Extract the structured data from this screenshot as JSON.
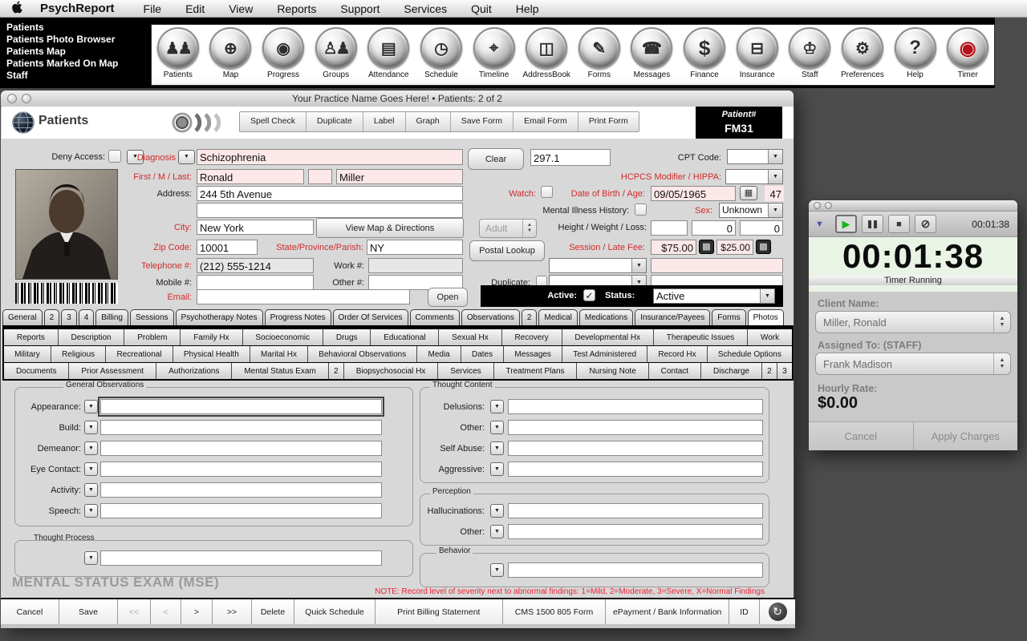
{
  "menu_bar": {
    "app": "PsychReport",
    "items": [
      "File",
      "Edit",
      "View",
      "Reports",
      "Support",
      "Services",
      "Quit",
      "Help"
    ]
  },
  "quick_menu": [
    "Patients",
    "Patients Photo Browser",
    "Patients Map",
    "Patients Marked On Map",
    "Staff"
  ],
  "toolbar_icons": [
    {
      "label": "Patients",
      "glyph": "♟♟"
    },
    {
      "label": "Map",
      "glyph": "⊕"
    },
    {
      "label": "Progress",
      "glyph": "◉"
    },
    {
      "label": "Groups",
      "glyph": "♙♟"
    },
    {
      "label": "Attendance",
      "glyph": "▤"
    },
    {
      "label": "Schedule",
      "glyph": "◷"
    },
    {
      "label": "Timeline",
      "glyph": "⌖"
    },
    {
      "label": "AddressBook",
      "glyph": "◫"
    },
    {
      "label": "Forms",
      "glyph": "✎"
    },
    {
      "label": "Messages",
      "glyph": "☎"
    },
    {
      "label": "Finance",
      "glyph": "$"
    },
    {
      "label": "Insurance",
      "glyph": "⊟"
    },
    {
      "label": "Staff",
      "glyph": "♔"
    },
    {
      "label": "Preferences",
      "glyph": "⚙"
    },
    {
      "label": "Help",
      "glyph": "?"
    },
    {
      "label": "Timer",
      "glyph": "◉"
    }
  ],
  "window": {
    "title": "Your Practice Name Goes Here! • Patients: 2 of 2",
    "section_title": "Patients",
    "header_buttons": [
      "Spell Check",
      "Duplicate",
      "Label",
      "Graph",
      "Save Form",
      "Email Form",
      "Print Form"
    ],
    "patient_no_label": "Patient#",
    "patient_no": "FM31"
  },
  "form": {
    "deny_access_label": "Deny Access:",
    "diagnosis_label": "Diagnosis",
    "diagnosis": "Schizophrenia",
    "clear_button": "Clear",
    "diagnosis_code": "297.1",
    "cpt_label": "CPT Code:",
    "name_label": "First / M / Last:",
    "first_name": "Ronald",
    "middle_name": "",
    "last_name": "Miller",
    "hcpcs_label": "HCPCS Modifier / HIPPA:",
    "address_label": "Address:",
    "address1": "244 5th Avenue",
    "address2": "",
    "watch_label": "Watch:",
    "dob_label": "Date of Birth / Age:",
    "dob": "09/05/1965",
    "age": "47",
    "mih_label": "Mental Illness History:",
    "sex_label": "Sex:",
    "sex": "Unknown",
    "city_label": "City:",
    "city": "New York",
    "map_button": "View Map & Directions",
    "age_group": "Adult",
    "hwl_label": "Height / Weight / Loss:",
    "height": "",
    "weight": "0",
    "loss": "0",
    "zip_label": "Zip Code:",
    "zip": "10001",
    "state_label": "State/Province/Parish:",
    "state": "NY",
    "postal_button": "Postal Lookup",
    "fee_label": "Session / Late Fee:",
    "session_fee": "$75.00",
    "late_fee": "$25.00",
    "phone_label": "Telephone #:",
    "phone": "(212) 555-1214",
    "work_label": "Work #:",
    "work": "",
    "mobile_label": "Mobile #:",
    "mobile": "",
    "other_label": "Other #:",
    "other": "",
    "duplicate_label": "Duplicate:",
    "email_label": "Email:",
    "email": "",
    "open_button": "Open",
    "active_label": "Active:",
    "status_label": "Status:",
    "status": "Active"
  },
  "tabs": {
    "row1": [
      "General",
      "2",
      "3",
      "4",
      "Billing",
      "Sessions",
      "Psychotherapy Notes",
      "Progress Notes",
      "Order Of Services",
      "Comments",
      "Observations",
      "2",
      "Medical",
      "Medications",
      "Insurance/Payees",
      "Forms",
      "Photos"
    ],
    "row2": [
      "Reports",
      "Description",
      "Problem",
      "Family Hx",
      "Socioeconomic",
      "Drugs",
      "Educational",
      "Sexual Hx",
      "Recovery",
      "Developmental Hx",
      "Therapeutic Issues",
      "Work"
    ],
    "row3": [
      "Military",
      "Religious",
      "Recreational",
      "Physical Health",
      "Marital Hx",
      "Behavioral Observations",
      "Media",
      "Dates",
      "Messages",
      "Test Administered",
      "Record Hx",
      "Schedule Options"
    ],
    "row4": [
      "Documents",
      "Prior Assessment",
      "Authorizations",
      "Mental Status Exam",
      "2",
      "Biopsychosocial Hx",
      "Services",
      "Treatment Plans",
      "Nursing Note",
      "Contact",
      "Discharge",
      "2",
      "3"
    ]
  },
  "mse": {
    "general_title": "General Observations",
    "general_fields": [
      "Appearance:",
      "Build:",
      "Demeanor:",
      "Eye Contact:",
      "Activity:",
      "Speech:"
    ],
    "thought_process_title": "Thought Process",
    "thought_content_title": "Thought Content",
    "thought_content_fields": [
      "Delusions:",
      "Other:",
      "Self Abuse:",
      "Aggressive:"
    ],
    "perception_title": "Perception",
    "perception_fields": [
      "Hallucinations:",
      "Other:"
    ],
    "behavior_title": "Behavior",
    "title": "MENTAL STATUS EXAM (MSE)",
    "note": "NOTE: Record level of severity next to abnormal findings: 1=Mild, 2=Moderate, 3=Severe, X=Normal Findings"
  },
  "bottom_toolbar": [
    "Cancel",
    "Save",
    "<<",
    "<",
    ">",
    ">>",
    "Delete",
    "Quick Schedule",
    "Print Billing Statement",
    "CMS 1500 805 Form",
    "ePayment / Bank Information",
    "ID"
  ],
  "timer": {
    "time": "00:01:38",
    "time_display": "00:01:38",
    "status": "Timer Running",
    "client_label": "Client Name:",
    "client": "Miller, Ronald",
    "assigned_label": "Assigned To: (STAFF)",
    "assigned": "Frank Madison",
    "rate_label": "Hourly Rate:",
    "rate": "$0.00",
    "cancel_button": "Cancel",
    "apply_button": "Apply Charges"
  },
  "colors": {
    "label_red": "#d32a2a",
    "pink_field": "#fce8e8",
    "timer_display_bg": "#e9f4e5",
    "accent_black": "#000000"
  }
}
